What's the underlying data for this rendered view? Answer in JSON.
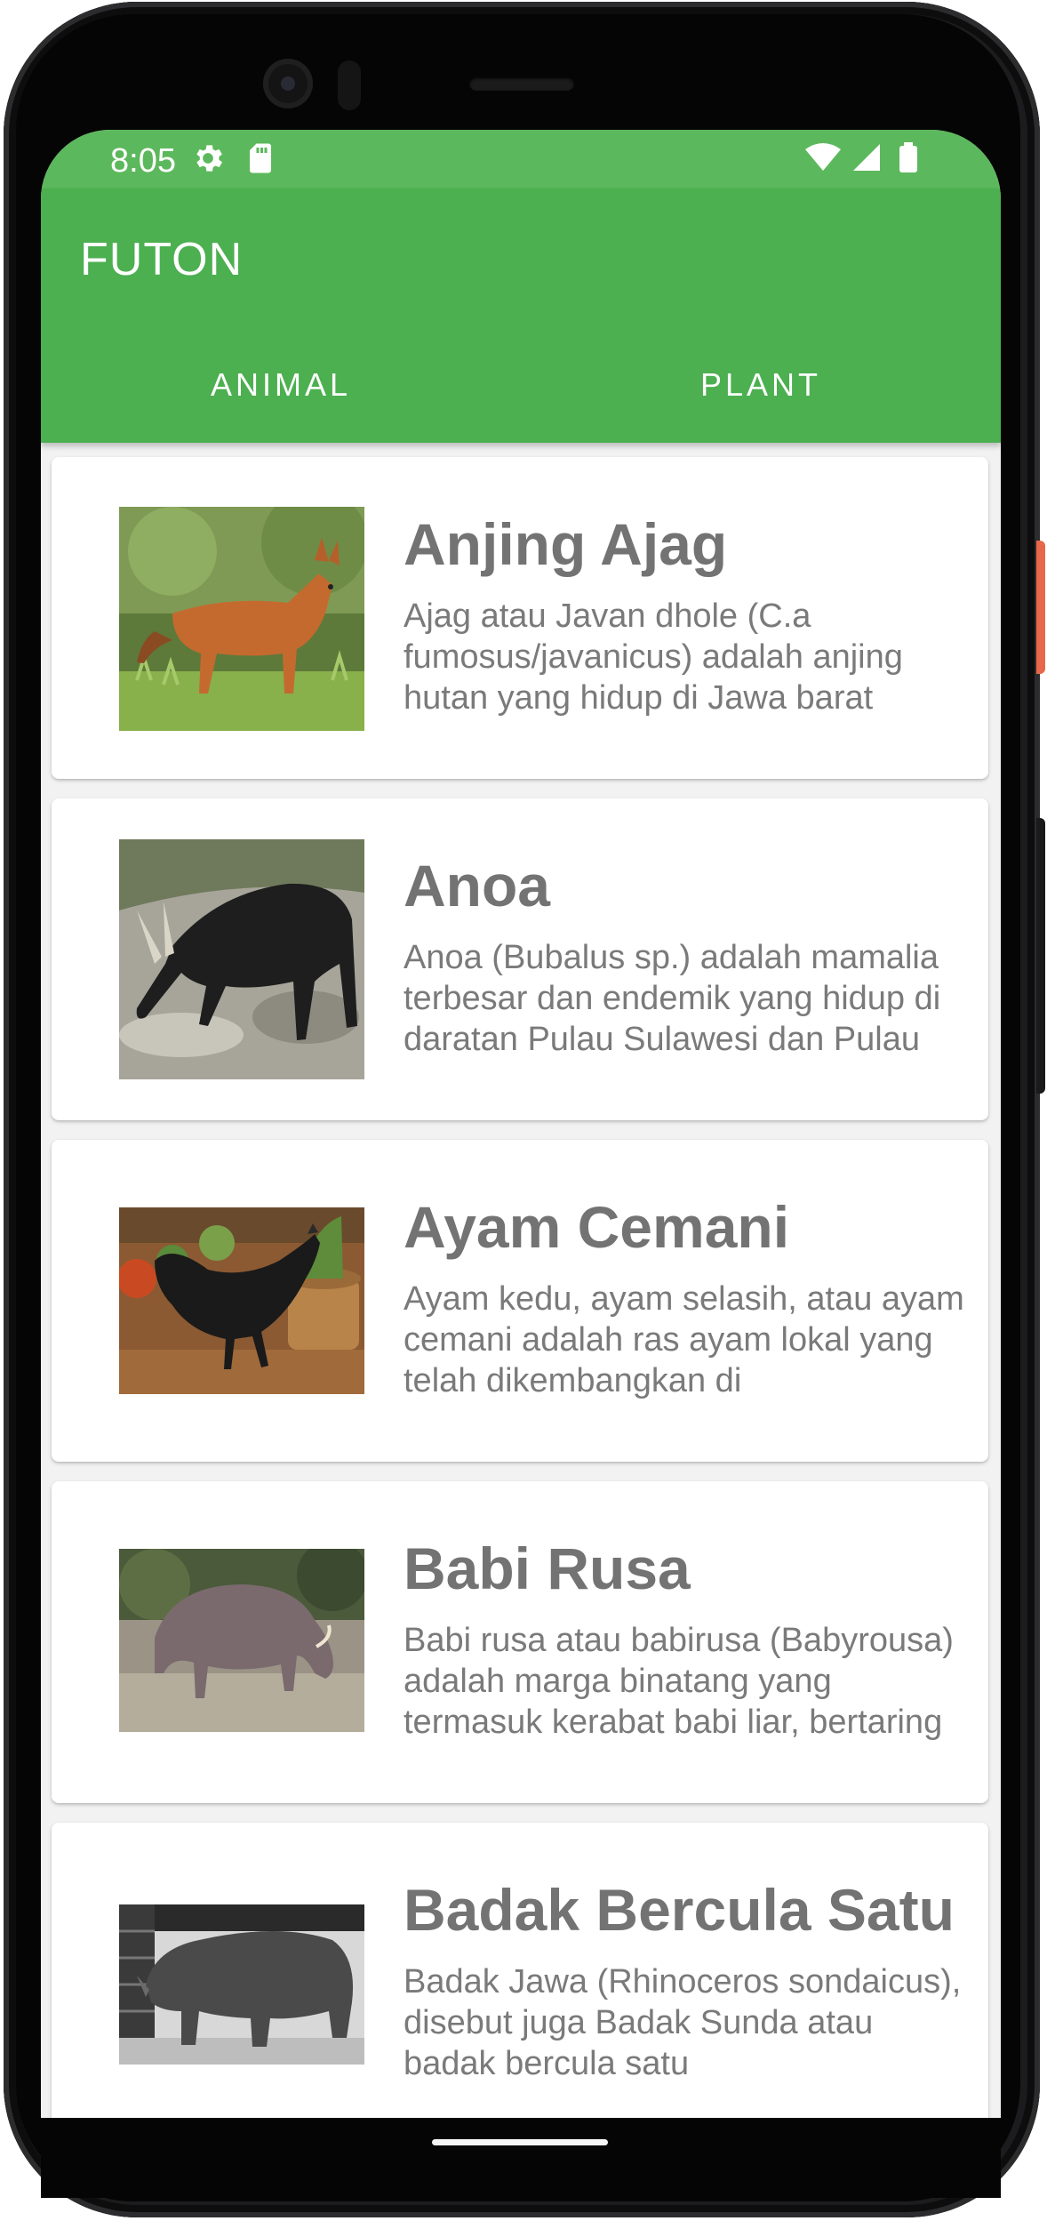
{
  "status_bar": {
    "time": "8:05",
    "icons": [
      "gear-icon",
      "sd-card-icon",
      "wifi-icon",
      "signal-icon",
      "battery-icon"
    ]
  },
  "app_bar": {
    "title": "FUTON",
    "tabs": [
      {
        "label": "ANIMAL",
        "selected": true
      },
      {
        "label": "PLANT",
        "selected": false
      }
    ]
  },
  "colors": {
    "status_bar": "#5cb85c",
    "app_bar": "#4caf50",
    "title_text": "#737373",
    "desc_text": "#7a7a7a"
  },
  "animals": [
    {
      "name": "Anjing Ajag",
      "description": "Ajag atau Javan dhole (C.a fumosus/javanicus) adalah anjing hutan yang hidup di Jawa barat",
      "image": "wild-dog-photo"
    },
    {
      "name": "Anoa",
      "description": "Anoa (Bubalus sp.) adalah mamalia terbesar dan endemik yang hidup di daratan Pulau Sulawesi dan Pulau",
      "image": "anoa-photo"
    },
    {
      "name": "Ayam Cemani",
      "description": "Ayam kedu, ayam selasih, atau ayam cemani adalah ras ayam lokal yang telah dikembangkan di",
      "image": "black-chicken-photo"
    },
    {
      "name": "Babi Rusa",
      "description": "Babi rusa atau babirusa (Babyrousa) adalah marga binatang yang termasuk kerabat babi liar, bertaring",
      "image": "babirusa-photo"
    },
    {
      "name": "Badak Bercula Satu",
      "description": "Badak Jawa (Rhinoceros sondaicus), disebut juga Badak Sunda atau badak bercula satu",
      "image": "rhinoceros-photo"
    }
  ]
}
